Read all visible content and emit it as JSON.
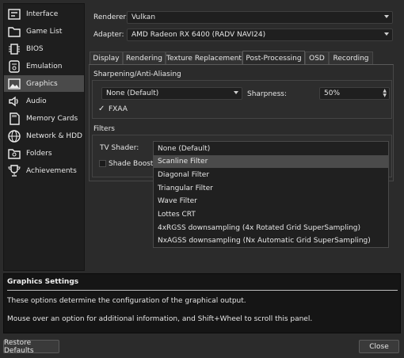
{
  "sidebar": {
    "items": [
      {
        "label": "Interface",
        "icon": "interface-icon"
      },
      {
        "label": "Game List",
        "icon": "folder-icon"
      },
      {
        "label": "BIOS",
        "icon": "chip-icon"
      },
      {
        "label": "Emulation",
        "icon": "gamepad-icon"
      },
      {
        "label": "Graphics",
        "icon": "image-icon"
      },
      {
        "label": "Audio",
        "icon": "speaker-icon"
      },
      {
        "label": "Memory Cards",
        "icon": "memory-card-icon"
      },
      {
        "label": "Network & HDD",
        "icon": "globe-icon"
      },
      {
        "label": "Folders",
        "icon": "folder-settings-icon"
      },
      {
        "label": "Achievements",
        "icon": "trophy-icon"
      }
    ],
    "active_index": 4
  },
  "renderer": {
    "label": "Renderer:",
    "value": "Vulkan"
  },
  "adapter": {
    "label": "Adapter:",
    "value": "AMD Radeon RX 6400 (RADV NAVI24)"
  },
  "tabs": [
    "Display",
    "Rendering",
    "Texture Replacement",
    "Post-Processing",
    "OSD",
    "Recording"
  ],
  "active_tab": 3,
  "sharpening": {
    "title": "Sharpening/Anti-Aliasing",
    "mode_value": "None (Default)",
    "sharpness_label": "Sharpness:",
    "sharpness_value": "50%",
    "fxaa_label": "FXAA",
    "fxaa_checked": true
  },
  "filters": {
    "title": "Filters",
    "tv_shader_label": "TV Shader:",
    "shade_boost_label": "Shade Boost",
    "shade_boost_checked": false
  },
  "shader_options": [
    "None (Default)",
    "Scanline Filter",
    "Diagonal Filter",
    "Triangular Filter",
    "Wave Filter",
    "Lottes CRT",
    "4xRGSS downsampling (4x Rotated Grid SuperSampling)",
    "NxAGSS downsampling (Nx Automatic Grid SuperSampling)"
  ],
  "shader_selected_index": 1,
  "info": {
    "title": "Graphics Settings",
    "line1": "These options determine the configuration of the graphical output.",
    "line2": "Mouse over an option for additional information, and Shift+Wheel to scroll this panel."
  },
  "buttons": {
    "restore_defaults": "Restore Defaults",
    "close": "Close"
  },
  "colors": {
    "background": "#2b2b2b",
    "sidebar": "#1e1e1e",
    "selection": "#4a4a4a"
  }
}
